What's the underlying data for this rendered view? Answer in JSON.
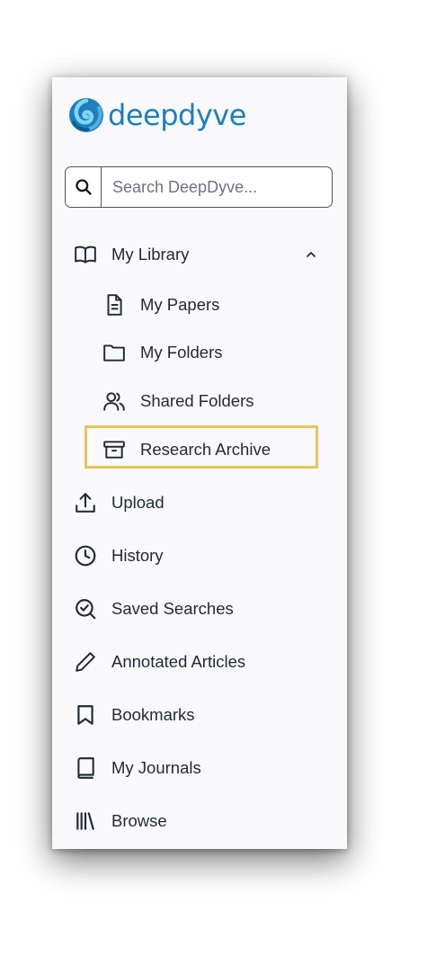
{
  "brand": {
    "name": "deepdyve",
    "logo_color": "#1d7fbf"
  },
  "search": {
    "placeholder": "Search DeepDyve...",
    "icon": "search-icon"
  },
  "nav": {
    "library": {
      "label": "My Library",
      "icon": "book-open-icon",
      "expanded": true,
      "children": [
        {
          "label": "My Papers",
          "icon": "document-icon"
        },
        {
          "label": "My Folders",
          "icon": "folder-icon"
        },
        {
          "label": "Shared Folders",
          "icon": "users-icon"
        },
        {
          "label": "Research Archive",
          "icon": "archive-icon",
          "highlighted": true
        }
      ]
    },
    "items": [
      {
        "label": "Upload",
        "icon": "upload-icon"
      },
      {
        "label": "History",
        "icon": "clock-icon"
      },
      {
        "label": "Saved Searches",
        "icon": "search-check-icon"
      },
      {
        "label": "Annotated Articles",
        "icon": "pencil-icon"
      },
      {
        "label": "Bookmarks",
        "icon": "bookmark-icon"
      },
      {
        "label": "My Journals",
        "icon": "journal-icon"
      },
      {
        "label": "Browse",
        "icon": "library-icon"
      }
    ]
  },
  "colors": {
    "highlight": "#e8c35f",
    "panel": "#f9f9fb",
    "text": "#1f2937"
  }
}
